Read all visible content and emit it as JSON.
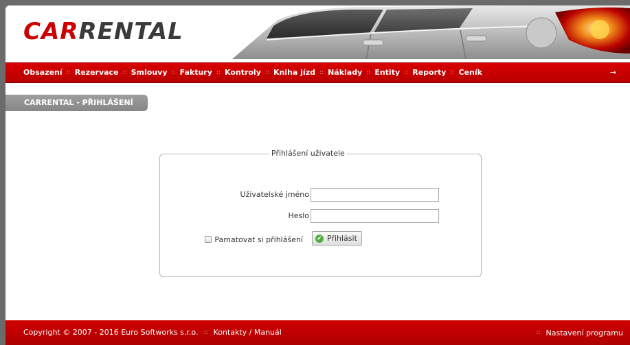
{
  "header": {
    "logo_part1": "CAR",
    "logo_part2": "RENTAL"
  },
  "nav": {
    "items": [
      "Obsazení",
      "Rezervace",
      "Smlouvy",
      "Faktury",
      "Kontroly",
      "Kniha jízd",
      "Náklady",
      "Entity",
      "Reporty",
      "Ceník"
    ],
    "separator": "::",
    "arrow": "→"
  },
  "page": {
    "title": "CARRENTAL - PŘIHLÁŠENÍ"
  },
  "login": {
    "legend": "Přihlášení uživatele",
    "username_label": "Uživatelské jméno",
    "username_value": "",
    "password_label": "Heslo",
    "password_value": "",
    "remember_label": "Pamatovat si přihlášení",
    "remember_checked": false,
    "submit_label": "Přihlásit"
  },
  "footer": {
    "copyright": "Copyright © 2007 - 2016 Euro Softworks s.r.o.",
    "separator": "::",
    "contacts_link": "Kontakty / Manuál",
    "settings_link": "Nastavení programu"
  },
  "colors": {
    "brand_red": "#cc0000",
    "nav_red": "#c80000",
    "title_tab_gray": "#8f8f8f",
    "accept_green": "#4fae3c"
  }
}
